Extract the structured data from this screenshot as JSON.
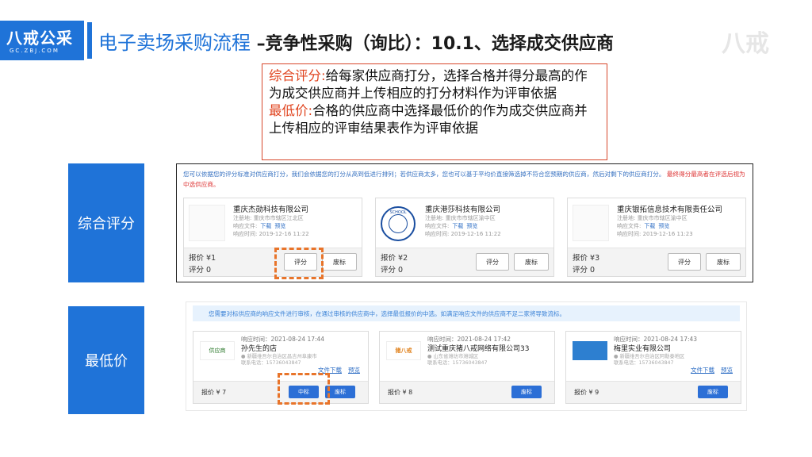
{
  "header": {
    "logo_main": "八戒公采",
    "logo_sub": "GC.ZBJ.COM",
    "title_main": "电子卖场采购流程",
    "title_sub": "–竞争性采购（询比）：10.1、选择成交供应商",
    "watermark": "八戒"
  },
  "description": {
    "comprehensive_head": "综合评分:",
    "comprehensive_body": "给每家供应商打分，选择合格并得分最高的作为成交供应商并上传相应的打分材料作为评审依据",
    "lowest_head": "最低价:",
    "lowest_body": "合格的供应商中选择最低价的作为成交供应商并上传相应的评审结果表作为评审依据"
  },
  "side_labels": {
    "comprehensive": "综合评分",
    "lowest": "最低价"
  },
  "panel1": {
    "note": "您可以依据您的评分标准对供应商打分，我们会依据您的打分从高到低进行排列；若供应商太多，您也可以基于平均价直接筛选掉不符合您预期的供应商，然后对剩下的供应商打分。",
    "note_red": "最终得分最高者在评选后视为中选供应商。",
    "meta_labels": {
      "reg": "注册地:",
      "doc": "响应文件:",
      "time": "响应时间:",
      "download": "下载",
      "preview": "预览"
    },
    "score_btn": "评分",
    "waste_btn": "废标",
    "cards": [
      {
        "name": "重庆杰勋科技有限公司",
        "reg": "重庆市市辖区江北区",
        "time": "2019-12-16 11:22",
        "price": "报价 ¥1",
        "score": "评分 0"
      },
      {
        "name": "重庆港莎科技有限公司",
        "reg": "重庆市市辖区渝中区",
        "time": "2019-12-16 11:22",
        "price": "报价 ¥2",
        "score": "评分 0",
        "logo_text": "SCHOOL"
      },
      {
        "name": "重庆银拓信息技术有限责任公司",
        "reg": "重庆市市辖区渝中区",
        "time": "2019-12-16 11:23",
        "price": "报价 ¥3",
        "score": "评分 0"
      }
    ]
  },
  "panel2": {
    "note": "您需要对标供应商的响应文件进行审核，在通过审核的供应商中，选择最低报价的中选。如满足响应文件的供应商不足二家将导致流标。",
    "file_download": "文件下载",
    "preview": "预览",
    "win_btn": "中标",
    "waste_btn": "废标",
    "cards": [
      {
        "time": "响应时间：2021-08-24 17:44",
        "name": "孙先生的店",
        "addr": "● 新疆维吾尔自治区昌吉州阜康市",
        "phone": "联系电话：15736043847",
        "price": "报价 ¥ 7",
        "thumb": "供应商"
      },
      {
        "time": "响应时间：2021-08-24 17:42",
        "name": "测试重庆猪八戒网络有限公司33",
        "addr": "● 山东省潍坊市潍城区",
        "phone": "联系电话：15736043847",
        "price": "报价 ¥ 8",
        "thumb": "猪八戒"
      },
      {
        "time": "响应时间：2021-08-24 17:43",
        "name": "梅里实业有限公司",
        "addr": "● 新疆维吾尔自治区阿勒泰地区",
        "phone": "联系电话：15736043847",
        "price": "报价 ¥ 9",
        "thumb": ""
      }
    ]
  },
  "colors": {
    "brand_blue": "#1f73d8",
    "highlight_orange": "#e8742a",
    "desc_red": "#e0441f"
  }
}
